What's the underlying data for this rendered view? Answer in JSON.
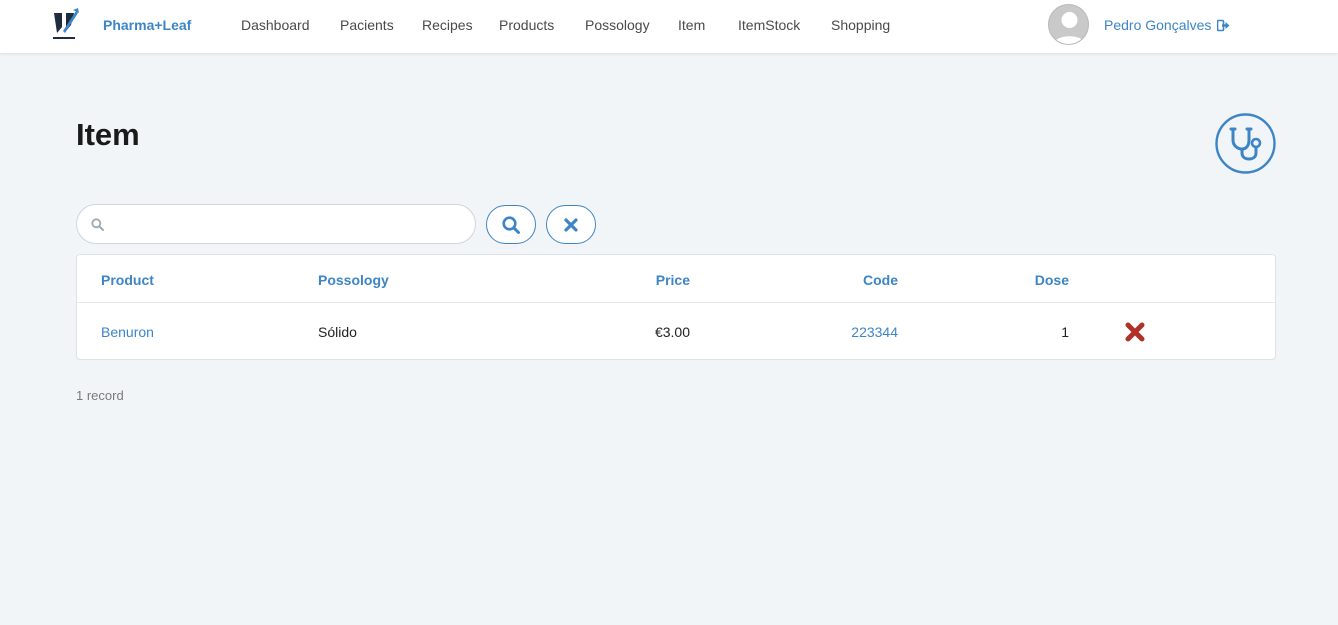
{
  "navbar": {
    "brand": "Pharma+Leaf",
    "links": [
      "Dashboard",
      "Pacients",
      "Recipes",
      "Products",
      "Possology",
      "Item",
      "ItemStock",
      "Shopping"
    ],
    "user_name": "Pedro Gonçalves",
    "accent_color": "#3d85c6"
  },
  "page": {
    "title": "Item",
    "header_icon": "stethoscope-icon"
  },
  "search": {
    "value": "",
    "placeholder": ""
  },
  "table": {
    "headers": {
      "product": "Product",
      "possology": "Possology",
      "price": "Price",
      "code": "Code",
      "dose": "Dose"
    },
    "rows": [
      {
        "product": "Benuron",
        "possology": "Sólido",
        "price": "€3.00",
        "code": "223344",
        "dose": "1"
      }
    ]
  },
  "footer": {
    "record_count": "1 record"
  },
  "colors": {
    "delete": "#b0302a",
    "background": "#f1f5f8"
  }
}
